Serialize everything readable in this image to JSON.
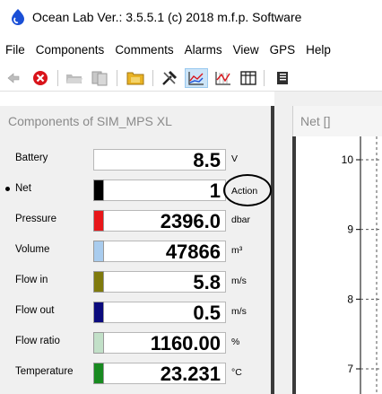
{
  "window": {
    "title": "Ocean Lab Ver.: 3.5.5.1  (c) 2018 m.f.p. Software"
  },
  "menu": [
    "File",
    "Components",
    "Comments",
    "Alarms",
    "View",
    "GPS",
    "Help"
  ],
  "toolbar": {
    "icons": [
      "back-arrow-icon",
      "stop-icon",
      "open-folder-icon",
      "save-icon",
      "folder-icon",
      "tools-icon",
      "chart-icon",
      "grid-chart-icon",
      "table-icon",
      "book-icon"
    ]
  },
  "components_panel": {
    "title": "Components of SIM_MPS XL",
    "rows": [
      {
        "label": "Battery",
        "value": "8.5",
        "unit": "V",
        "color": "#ffffff",
        "selected": false
      },
      {
        "label": "Net",
        "value": "1",
        "unit": "Action",
        "color": "#000000",
        "selected": true
      },
      {
        "label": "Pressure",
        "value": "2396.0",
        "unit": "dbar",
        "color": "#e8171a"
      },
      {
        "label": "Volume",
        "value": "47866",
        "unit": "m³",
        "color": "#a9ccee"
      },
      {
        "label": "Flow in",
        "value": "5.8",
        "unit": "m/s",
        "color": "#7f7a0d"
      },
      {
        "label": "Flow out",
        "value": "0.5",
        "unit": "m/s",
        "color": "#0b0b7d"
      },
      {
        "label": "Flow ratio",
        "value": "1160.00",
        "unit": "%",
        "color": "#c2e0c8"
      },
      {
        "label": "Temperature",
        "value": "23.231",
        "unit": "°C",
        "color": "#188a20"
      }
    ]
  },
  "chart_panel": {
    "tab_title": "Net  []"
  },
  "chart_data": {
    "type": "line",
    "title": "",
    "xlabel": "",
    "ylabel": "",
    "yticks": [
      10,
      9,
      8,
      7
    ],
    "ylim": [
      6.7,
      10.2
    ],
    "grid": true,
    "series": []
  }
}
